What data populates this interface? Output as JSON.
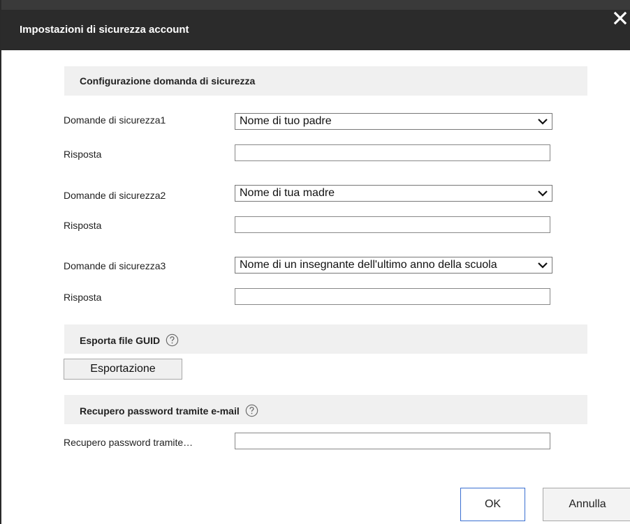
{
  "dialog": {
    "title": "Impostazioni di sicurezza account",
    "close_icon": "close-icon"
  },
  "security_questions": {
    "section_title": "Configurazione domanda di sicurezza",
    "items": [
      {
        "question_label": "Domande di sicurezza1",
        "question_value": "Nome di tuo padre",
        "answer_label": "Risposta",
        "answer_value": ""
      },
      {
        "question_label": "Domande di sicurezza2",
        "question_value": "Nome di tua madre",
        "answer_label": "Risposta",
        "answer_value": ""
      },
      {
        "question_label": "Domande di sicurezza3",
        "question_value": "Nome di un insegnante dell'ultimo anno della scuola",
        "answer_label": "Risposta",
        "answer_value": ""
      }
    ]
  },
  "guid_export": {
    "section_title": "Esporta file GUID",
    "help_icon": "help-icon",
    "export_button_label": "Esportazione"
  },
  "email_recovery": {
    "section_title": "Recupero password tramite e-mail",
    "help_icon": "help-icon",
    "field_label": "Recupero password tramite…",
    "field_value": ""
  },
  "footer": {
    "ok_label": "OK",
    "cancel_label": "Annulla"
  },
  "colors": {
    "titlebar_bg": "#2b2b2b",
    "title_text": "#ffffff",
    "section_bg": "#f0f0f0",
    "ok_border": "#3a6fd1"
  }
}
